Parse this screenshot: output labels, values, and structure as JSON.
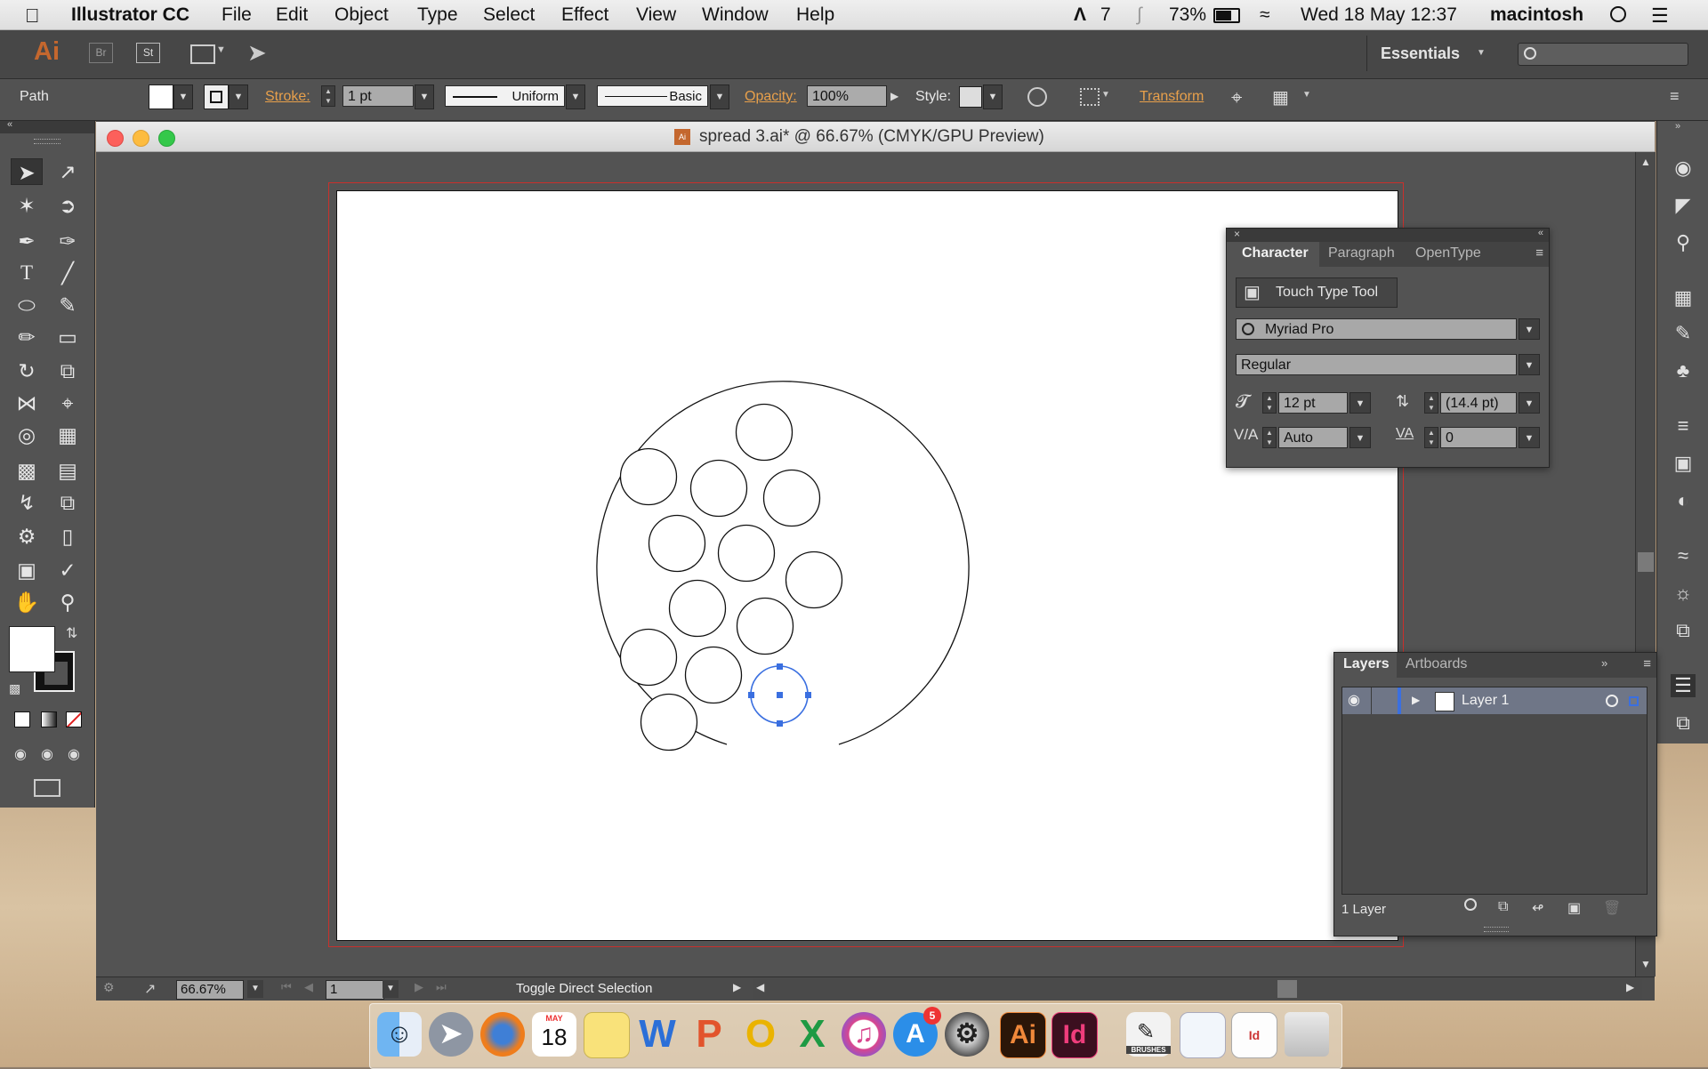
{
  "menubar": {
    "app_name": "Illustrator CC",
    "menus": [
      "File",
      "Edit",
      "Object",
      "Type",
      "Select",
      "Effect",
      "View",
      "Window",
      "Help"
    ],
    "adobe_badge": "7",
    "battery": "73%",
    "clock": "Wed 18 May  12:37",
    "user": "macintosh"
  },
  "appbar": {
    "logo": "Ai",
    "bridge": "Br",
    "stock": "St",
    "workspace": "Essentials"
  },
  "control": {
    "selection_type": "Path",
    "stroke_label": "Stroke:",
    "stroke_weight": "1 pt",
    "profile_label": "Uniform",
    "brush_label": "Basic",
    "opacity_label": "Opacity:",
    "opacity_value": "100%",
    "style_label": "Style:",
    "transform_label": "Transform"
  },
  "document": {
    "title": "spread 3.ai* @ 66.67% (CMYK/GPU Preview)"
  },
  "status": {
    "zoom": "66.67%",
    "artboard": "1",
    "tool_hint": "Toggle Direct Selection"
  },
  "character_panel": {
    "tabs": [
      "Character",
      "Paragraph",
      "OpenType"
    ],
    "touch_type": "Touch Type Tool",
    "font_family": "Myriad Pro",
    "font_style": "Regular",
    "size": "12 pt",
    "leading": "(14.4 pt)",
    "kerning": "Auto",
    "tracking": "0"
  },
  "layers_panel": {
    "tabs": [
      "Layers",
      "Artboards"
    ],
    "layers": [
      {
        "name": "Layer 1"
      }
    ],
    "count": "1 Layer"
  },
  "colors": {
    "accent": "#e8a04b",
    "selection": "#3a6fe0",
    "artboard_border": "#c9302c"
  },
  "dock": {
    "calendar_month": "MAY",
    "calendar_day": "18",
    "appstore_badge": "5",
    "brushes_label": "BRUSHES"
  }
}
